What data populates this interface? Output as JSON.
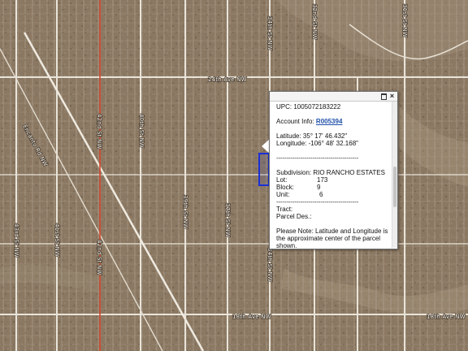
{
  "map": {
    "road_labels": {
      "ave_24th": "24th Ave NW",
      "ave_18th": "18th Ave NW",
      "ave_18th_right": "18th Ave NW",
      "encanto": "Encanto Rd NW",
      "street_42": "42nd St NW",
      "street_43": "43rd St NW",
      "street_41": "41st St NW",
      "street_40": "40th St NW",
      "street_39": "39th St NW",
      "street_38": "38th St NW",
      "street_37": "37th St NW",
      "street_36": "36th St NW",
      "street_34": "34th St NW",
      "street_32": "32nd St NW",
      "street_31": "31st St NW"
    }
  },
  "popup": {
    "upc": "UPC: 1005072183222",
    "account_label": "Account Info: ",
    "account_link": "R005394",
    "latitude": "Latitude: 35° 17' 46.432\"",
    "longitude": "Longitude: -106° 48' 32.168\"",
    "separator": "-----------------------------------------",
    "subdivision": "Subdivision: RIO RANCHO ESTATES",
    "lot_label": "Lot:",
    "lot_value": "173",
    "block_label": "Block:",
    "block_value": "9",
    "unit_label": "Unit:",
    "unit_value": "6",
    "tract": "Tract:",
    "parcel_des": "Parcel Des.:",
    "note": "Please Note: Latitude and Longitude is the approximate center of the parcel shown.",
    "close_glyph": "×"
  },
  "colors": {
    "parcel_highlight": "#1a2fd6",
    "road_red": "#d2452d",
    "popup_link": "#1f4fa8"
  }
}
